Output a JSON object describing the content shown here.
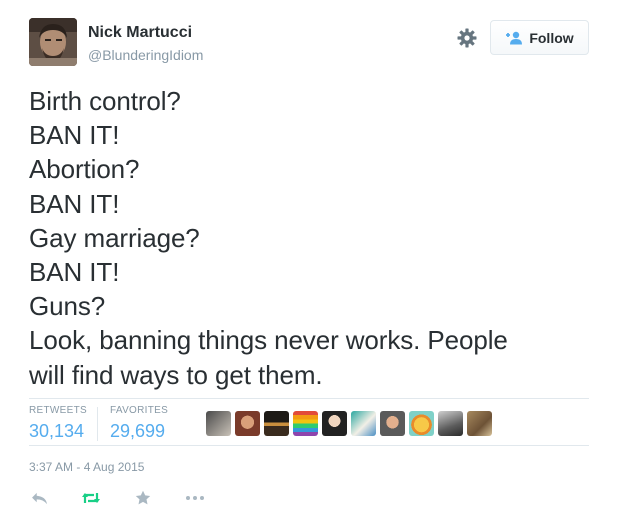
{
  "tweet": {
    "author": {
      "name": "Nick Martucci",
      "handle": "@BlunderingIdiom",
      "avatar_icon": "user-photo"
    },
    "follow_button_label": "Follow",
    "text_lines": [
      "Birth control?",
      "BAN IT!",
      "Abortion?",
      "BAN IT!",
      "Gay marriage?",
      "BAN IT!",
      "Guns?",
      "Look, banning things never works. People",
      "will find ways to get them."
    ],
    "stats": {
      "retweets_label": "RETWEETS",
      "retweets_value": "30,134",
      "favorites_label": "FAVORITES",
      "favorites_value": "29,699"
    },
    "favoriter_avatars": [
      "avatar-1",
      "avatar-2",
      "avatar-3",
      "avatar-4",
      "avatar-5",
      "avatar-6",
      "avatar-7",
      "avatar-8",
      "avatar-9",
      "avatar-10"
    ],
    "timestamp": "3:37 AM - 4 Aug 2015",
    "actions": [
      "reply-icon",
      "retweet-icon",
      "favorite-icon",
      "more-icon"
    ]
  },
  "colors": {
    "text": "#292f33",
    "muted": "#8899a6",
    "link_blue": "#55acee",
    "retweet_green": "#19cf86",
    "border": "#e1e8ed",
    "action_gray": "#aab8c2"
  }
}
